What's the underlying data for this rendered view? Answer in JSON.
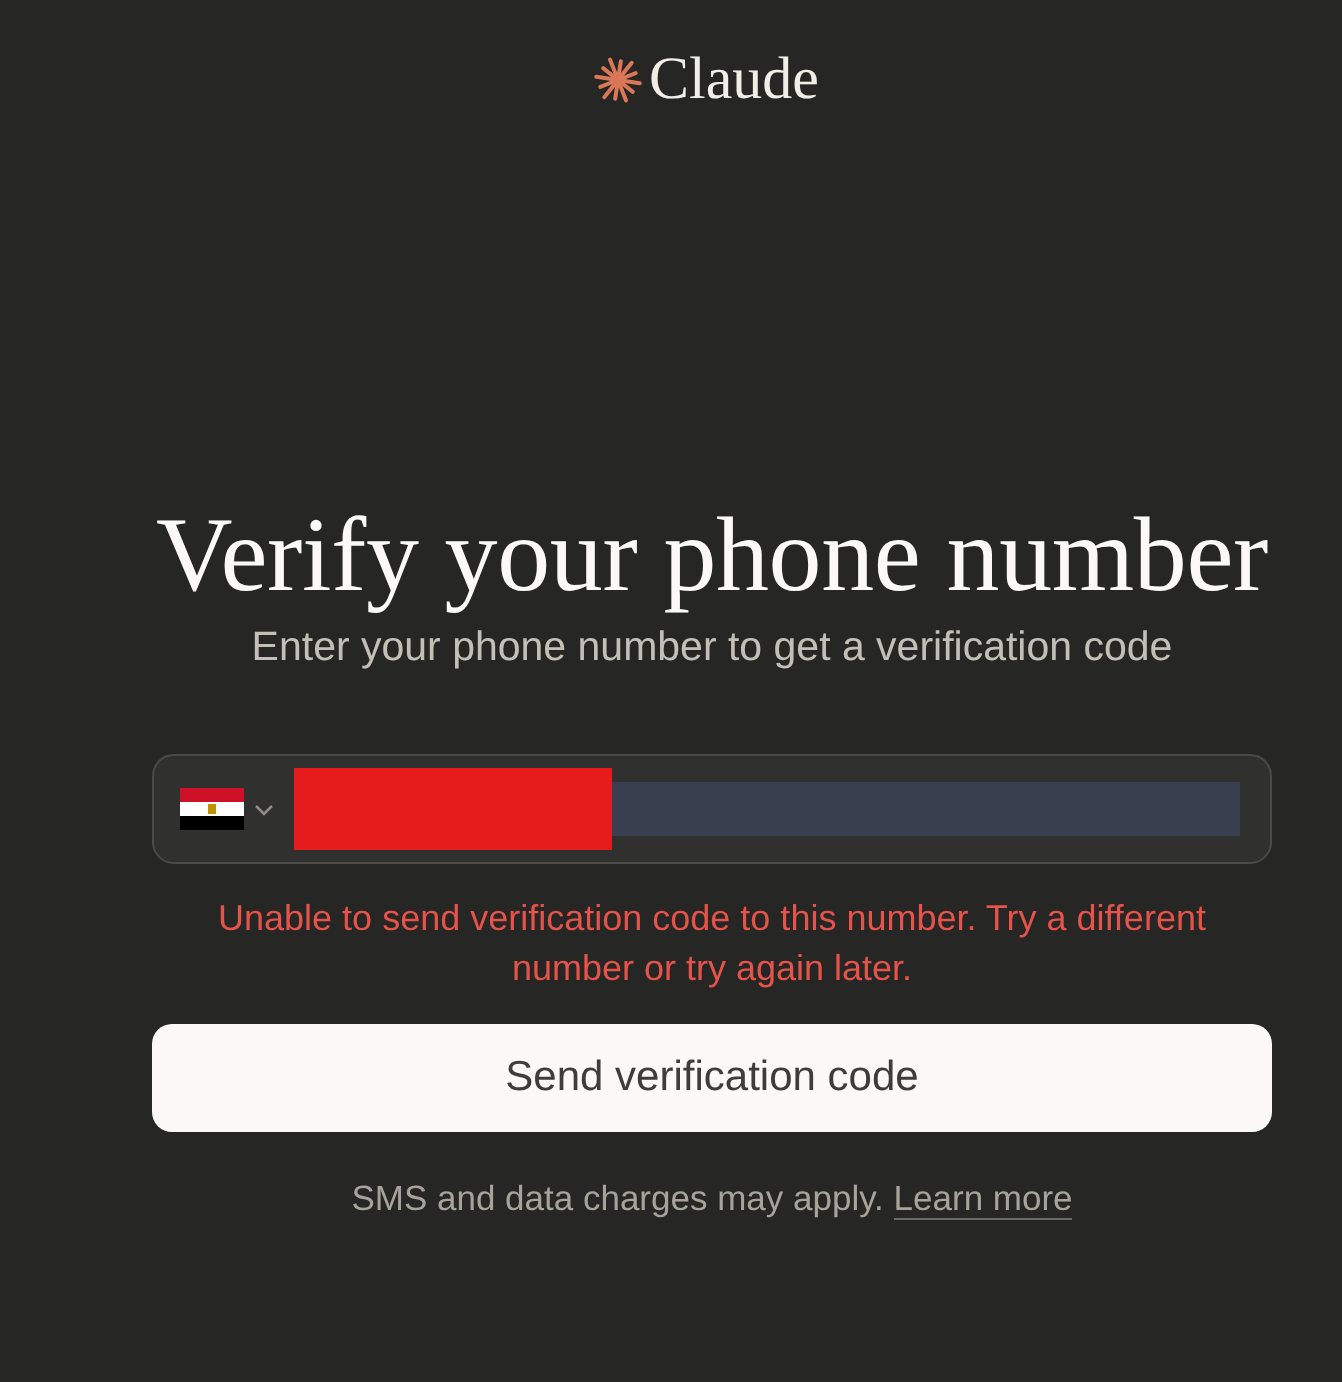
{
  "logo": {
    "name": "Claude"
  },
  "title": "Verify your phone number",
  "subtitle": "Enter your phone number to get a verification code",
  "phone_form": {
    "redacted": true,
    "error": "Unable to send verification code to this number. Try a different number or try again later.",
    "button": "Send verification code"
  },
  "footer": {
    "text": "SMS and data charges may apply.",
    "link": "Learn more"
  }
}
